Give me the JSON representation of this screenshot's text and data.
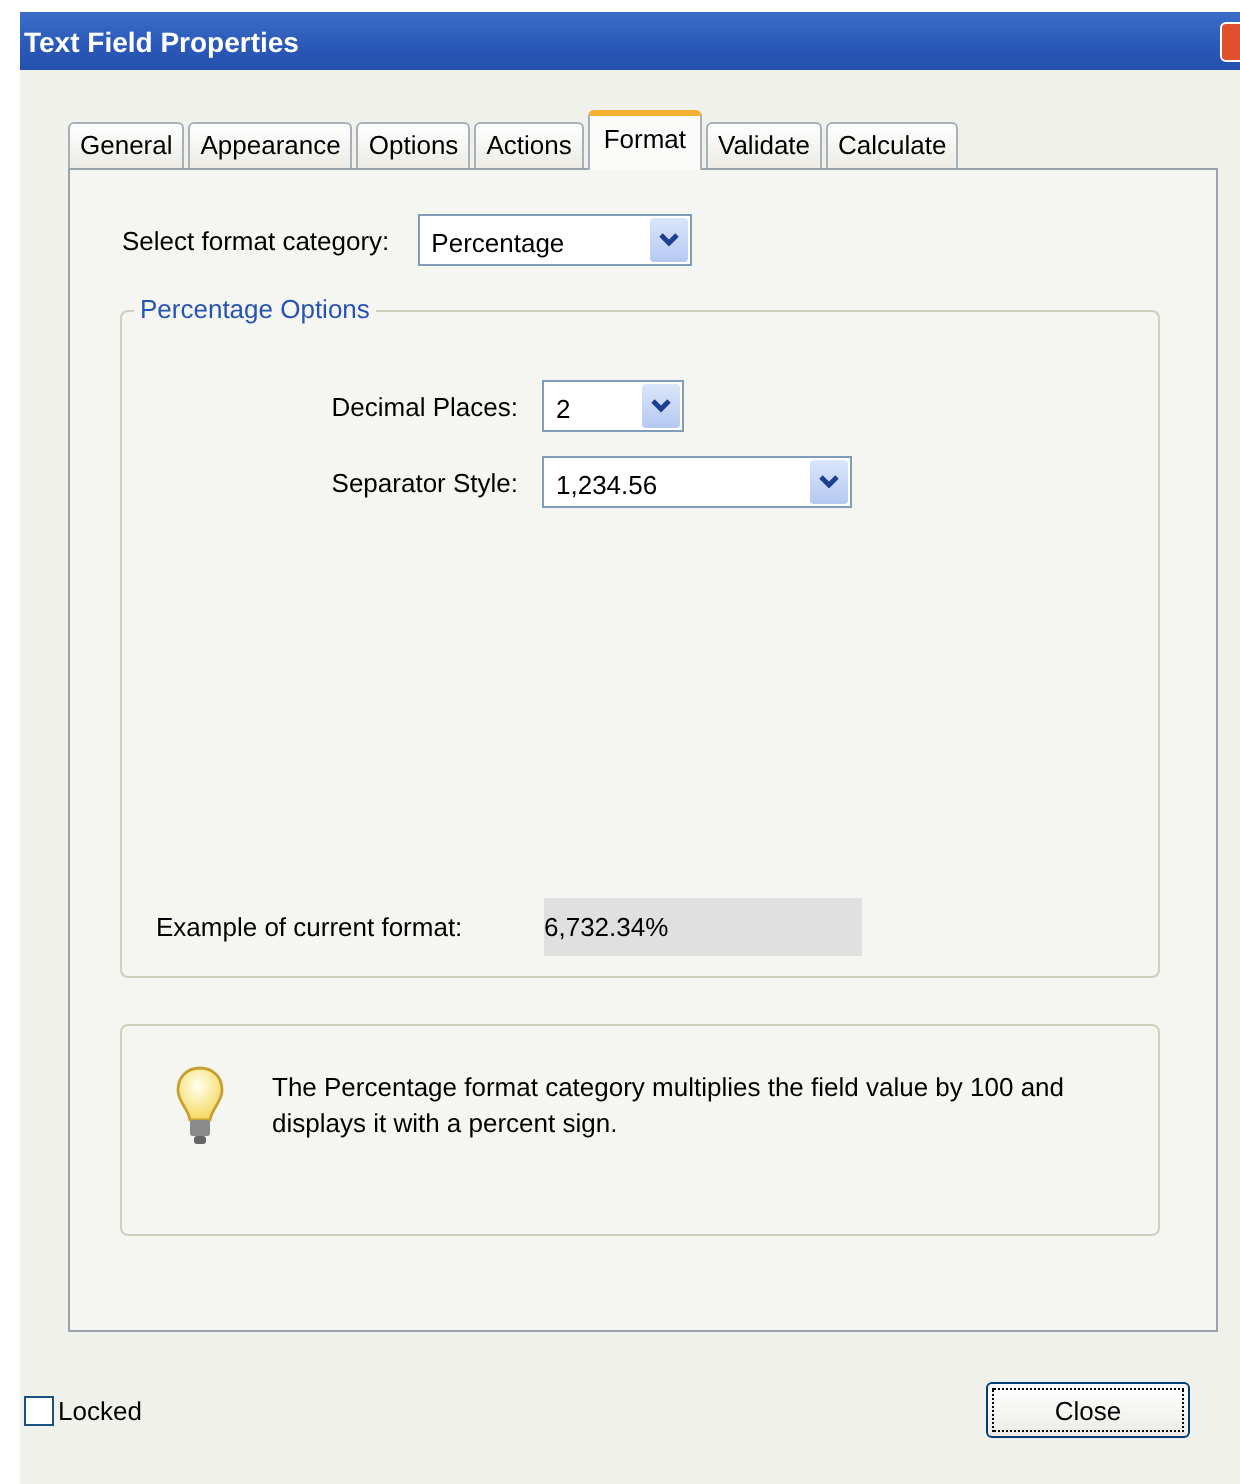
{
  "window": {
    "title": "Text Field Properties"
  },
  "tabs": [
    {
      "label": "General",
      "selected": false
    },
    {
      "label": "Appearance",
      "selected": false
    },
    {
      "label": "Options",
      "selected": false
    },
    {
      "label": "Actions",
      "selected": false
    },
    {
      "label": "Format",
      "selected": true
    },
    {
      "label": "Validate",
      "selected": false
    },
    {
      "label": "Calculate",
      "selected": false
    }
  ],
  "format_category": {
    "label": "Select format category:",
    "value": "Percentage"
  },
  "options_group": {
    "title": "Percentage Options",
    "fields": [
      {
        "label": "Decimal Places:",
        "value": "2"
      },
      {
        "label": "Separator Style:",
        "value": "1,234.56"
      }
    ]
  },
  "example": {
    "label": "Example of current format:",
    "value": "6,732.34%"
  },
  "info": {
    "text": "The Percentage format category multiplies the field value by 100 and displays it with a percent sign."
  },
  "locked": {
    "label": "Locked",
    "checked": false
  },
  "buttons": [
    "Close"
  ]
}
